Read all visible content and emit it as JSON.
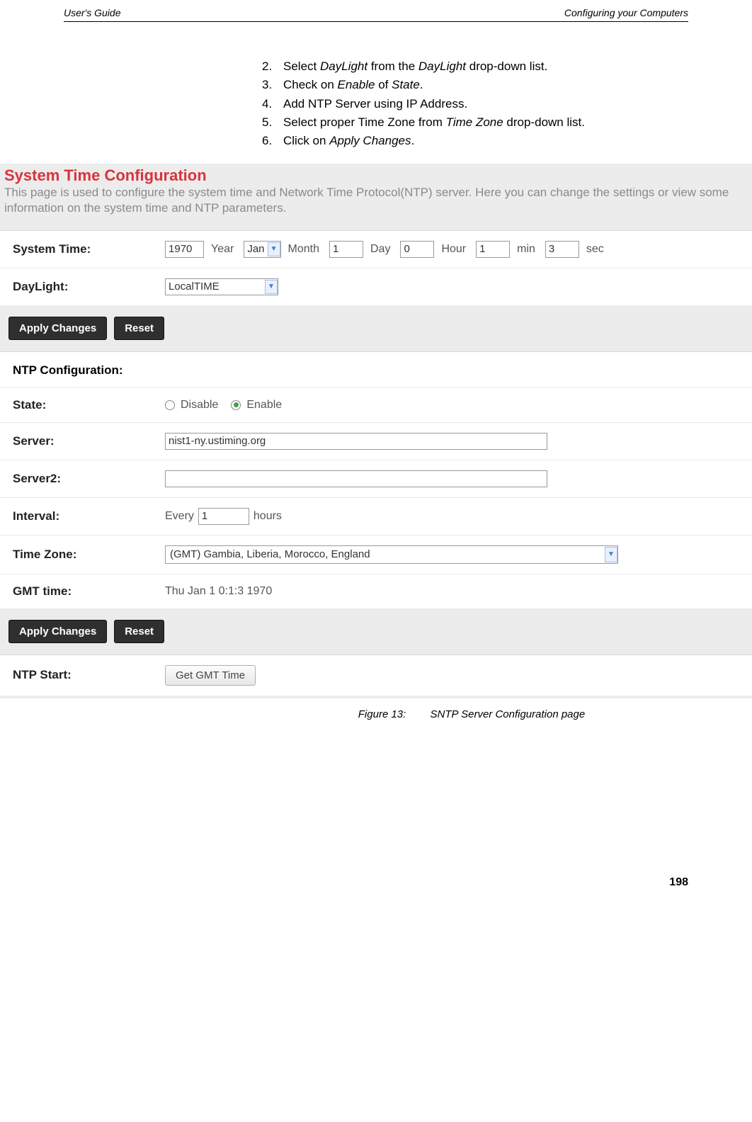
{
  "header": {
    "left": "User's Guide",
    "right": "Configuring your Computers"
  },
  "steps": [
    {
      "n": "2.",
      "parts": [
        "Select ",
        "DayLight",
        " from the ",
        "DayLight",
        " drop-down list."
      ]
    },
    {
      "n": "3.",
      "parts": [
        "Check on ",
        "Enable",
        " of ",
        "State",
        "."
      ]
    },
    {
      "n": "4.",
      "plain": "Add NTP Server using IP Address."
    },
    {
      "n": "5.",
      "parts": [
        "Select proper Time Zone from ",
        "Time Zone",
        " drop-down list."
      ]
    },
    {
      "n": "6.",
      "parts": [
        "Click on ",
        "Apply Changes",
        "."
      ]
    }
  ],
  "screenshot": {
    "title": "System Time Configuration",
    "desc": "This page is used to configure the system time and Network Time Protocol(NTP) server. Here you can change the settings or view some information on the system time and NTP parameters.",
    "systime": {
      "label": "System Time:",
      "year": "1970",
      "yearUnit": "Year",
      "month": "Jan",
      "monthUnit": "Month",
      "day": "1",
      "dayUnit": "Day",
      "hour": "0",
      "hourUnit": "Hour",
      "min": "1",
      "minUnit": "min",
      "sec": "3",
      "secUnit": "sec"
    },
    "daylight": {
      "label": "DayLight:",
      "value": "LocalTIME"
    },
    "buttons": {
      "apply": "Apply Changes",
      "reset": "Reset"
    },
    "ntp": {
      "header": "NTP Configuration:",
      "stateLabel": "State:",
      "disable": "Disable",
      "enable": "Enable",
      "serverLabel": "Server:",
      "server": "nist1-ny.ustiming.org",
      "server2Label": "Server2:",
      "server2": "",
      "intervalLabel": "Interval:",
      "intervalPrefix": "Every",
      "interval": "1",
      "intervalUnit": "hours",
      "tzLabel": "Time Zone:",
      "tz": "(GMT) Gambia, Liberia, Morocco, England",
      "gmtLabel": "GMT time:",
      "gmt": "Thu Jan 1 0:1:3 1970",
      "startLabel": "NTP Start:",
      "startBtn": "Get GMT Time"
    }
  },
  "caption": {
    "fig": "Figure 13:",
    "text": "SNTP Server Configuration page"
  },
  "pageNumber": "198"
}
